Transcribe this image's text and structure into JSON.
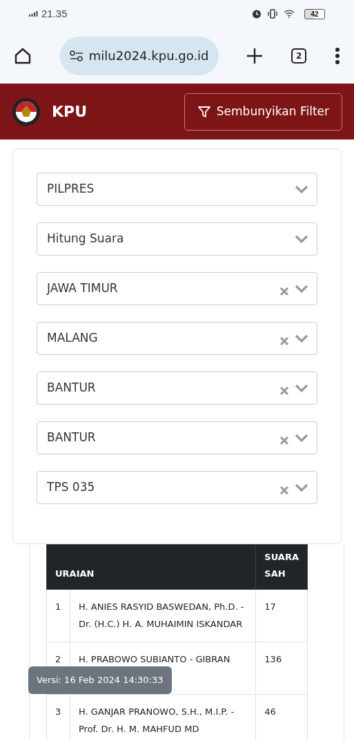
{
  "status_bar": {
    "time": "21.35",
    "battery": "42"
  },
  "browser": {
    "url": "milu2024.kpu.go.id",
    "tab_count": "2"
  },
  "header": {
    "brand": "KPU",
    "filter_button": "Sembunyikan Filter"
  },
  "filters": [
    {
      "value": "PILPRES",
      "clearable": false
    },
    {
      "value": "Hitung Suara",
      "clearable": false
    },
    {
      "value": "JAWA TIMUR",
      "clearable": true
    },
    {
      "value": "MALANG",
      "clearable": true
    },
    {
      "value": "BANTUR",
      "clearable": true
    },
    {
      "value": "BANTUR",
      "clearable": true
    },
    {
      "value": "TPS 035",
      "clearable": true
    }
  ],
  "table": {
    "columns": [
      "URAIAN",
      "SUARA SAH"
    ],
    "rows": [
      {
        "number": "1",
        "name": "H. ANIES RASYID BASWEDAN, Ph.D. - Dr. (H.C.) H. A. MUHAIMIN ISKANDAR",
        "votes": "17"
      },
      {
        "number": "2",
        "name": "H. PRABOWO SUBIANTO - GIBRAN",
        "votes": "136"
      },
      {
        "number": "3",
        "name": "H. GANJAR PRANOWO, S.H., M.I.P. - Prof. Dr. H. M. MAHFUD MD",
        "votes": "46"
      }
    ]
  },
  "tooltip": "Versi: 16 Feb 2024 14:30:33"
}
